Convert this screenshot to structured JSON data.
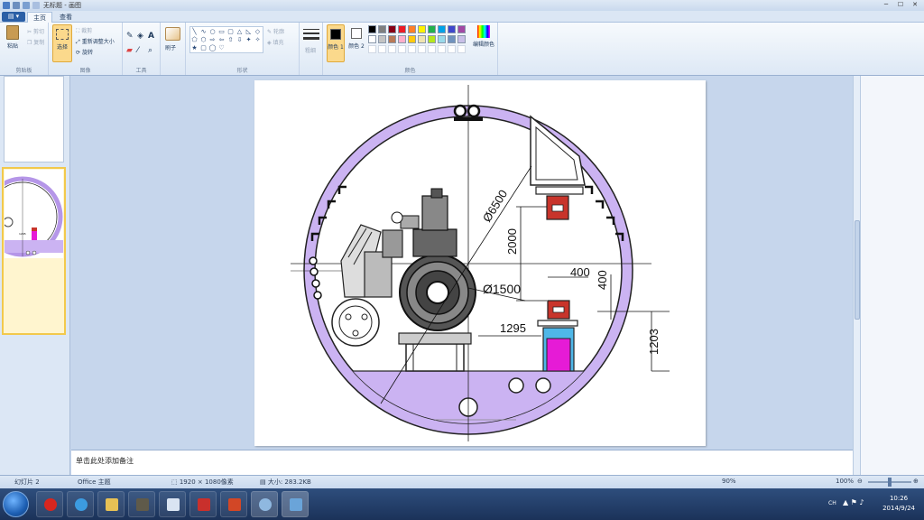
{
  "window": {
    "title": "无标题 - 画图"
  },
  "tabs": {
    "app_menu": "▤ ▾",
    "home": "主页",
    "view": "查看"
  },
  "ribbon": {
    "clipboard": {
      "paste": "粘贴",
      "cut": "剪切",
      "copy": "复制",
      "label": "剪贴板"
    },
    "image": {
      "select": "选择",
      "crop": "裁剪",
      "resize": "重新调整大小",
      "rotate": "旋转",
      "label": "图像"
    },
    "tools": {
      "label": "工具"
    },
    "brushes": {
      "label": "刷子"
    },
    "shapes": {
      "outline": "轮廓",
      "fill": "填充",
      "label": "形状"
    },
    "size": {
      "label": "粗细"
    },
    "colors": {
      "color1": "颜色 1",
      "color2": "颜色 2",
      "edit": "编辑颜色",
      "label": "颜色"
    }
  },
  "palette": [
    "#000000",
    "#7f7f7f",
    "#880015",
    "#ed1c24",
    "#ff7f27",
    "#fff200",
    "#22b14c",
    "#00a2e8",
    "#3f48cc",
    "#a349a4",
    "#ffffff",
    "#c3c3c3",
    "#b97a57",
    "#ffaec9",
    "#ffc90e",
    "#efe4b0",
    "#b5e61d",
    "#99d9ea",
    "#7092be",
    "#c8bfe7"
  ],
  "drawing": {
    "dim_diameter_outer": "Ø6500",
    "dim_diameter_inner": "Ø1500",
    "dim_2000": "2000",
    "dim_400_h": "400",
    "dim_400_v": "400",
    "dim_1295": "1295",
    "dim_1203": "1203"
  },
  "thumb": {
    "dim_label": "1295"
  },
  "notes": {
    "placeholder": "单击此处添加备注"
  },
  "status": {
    "dimensions": "1920 × 1080像素",
    "size": "大小: 283.2KB",
    "zoom": "100%",
    "slide_info": "幻灯片 2",
    "theme": "Office 主题",
    "ppt_zoom": "90%"
  },
  "taskbar": {
    "lang": "CH",
    "time": "10:26",
    "date": "2014/9/24"
  }
}
